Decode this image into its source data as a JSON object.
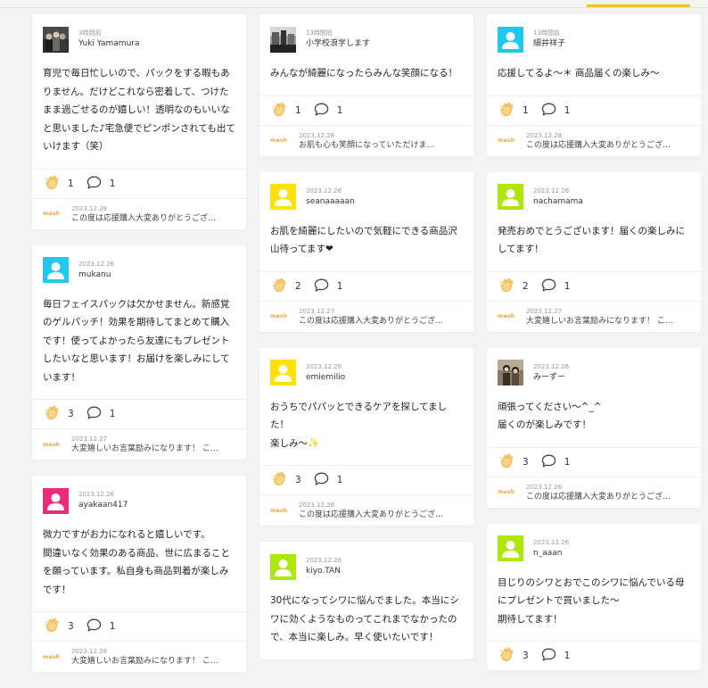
{
  "brand_label": "mash",
  "columns": [
    [
      {
        "avatar": "photo-group",
        "time": "3時間前",
        "user": "Yuki Yamamura",
        "text": "育児で毎日忙しいので、パックをする暇もありません。だけどこれなら密着して、つけたまま過ごせるのが嬉しい！透明なのもいいなと思いました♪宅急便でピンポンされても出ていけます（笑）",
        "claps": "1",
        "comments": "1",
        "reply_date": "2023.12.28",
        "reply_text": "この度は応援購入大変ありがとうござ…"
      },
      {
        "avatar": "cyan",
        "time": "2023.12.26",
        "user": "mukanu",
        "text": "毎日フェイスパックは欠かせません。新感覚のゲルパッチ！効果を期待してまとめて購入です！使ってよかったら友達にもプレゼントしたいなと思います！お届けを楽しみにしています！",
        "claps": "3",
        "comments": "1",
        "reply_date": "2023.12.27",
        "reply_text": "大変嬉しいお言葉励みになります！ こ…"
      },
      {
        "avatar": "pink",
        "time": "2023.12.26",
        "user": "ayakaan417",
        "text": "微力ですがお力になれると嬉しいです。\n間違いなく効果のある商品、世に広まることを願っています。私自身も商品到着が楽しみです！",
        "claps": "3",
        "comments": "1",
        "reply_date": "2023.12.26",
        "reply_text": "大変嬉しいお言葉励みになります！ こ…"
      }
    ],
    [
      {
        "avatar": "photo-street",
        "time": "13時間前",
        "user": "小学校浪学します",
        "text": "みんなが綺麗になったらみんな笑顔になる！",
        "claps": "1",
        "comments": "1",
        "reply_date": "2023.12.28",
        "reply_text": "お肌も心も笑顔になっていただけま…"
      },
      {
        "avatar": "yellow",
        "time": "2023.12.26",
        "user": "seanaaaaan",
        "text": "お肌を綺麗にしたいので気軽にできる商品沢山待ってます❤",
        "claps": "2",
        "comments": "1",
        "reply_date": "2023.12.27",
        "reply_text": "この度は応援購入大変ありがとうござ…"
      },
      {
        "avatar": "yellow",
        "time": "2023.12.26",
        "user": "emiemilio",
        "text": "おうちでパパッとできるケアを探してました！\n楽しみ～✨",
        "claps": "3",
        "comments": "1",
        "reply_date": "2023.12.26",
        "reply_text": "この度は応援購入大変ありがとうござ…"
      },
      {
        "avatar": "lime",
        "time": "2023.12.26",
        "user": "kiyo.TAN",
        "text": "30代になってシワに悩んでました。本当にシワに効くようなものってこれまでなかったので、本当に楽しみ。早く使いたいです！",
        "claps": "",
        "comments": "",
        "reply_date": "",
        "reply_text": ""
      }
    ],
    [
      {
        "avatar": "cyan",
        "time": "13時間前",
        "user": "細井祥子",
        "text": "応援してるよ～＊ 商品届くの楽しみ～",
        "claps": "1",
        "comments": "1",
        "reply_date": "2023.12.28",
        "reply_text": "この度は応援購入大変ありがとうござ…"
      },
      {
        "avatar": "lime",
        "time": "2023.12.26",
        "user": "nachamama",
        "text": "発売おめでとうございます！届くの楽しみにしてます！",
        "claps": "2",
        "comments": "1",
        "reply_date": "2023.12.27",
        "reply_text": "大変嬉しいお言葉励みになります！ こ…"
      },
      {
        "avatar": "photo-girl",
        "time": "2023.12.26",
        "user": "みーずー",
        "text": "頑張ってください～^_^\n届くのが楽しみです！",
        "claps": "3",
        "comments": "1",
        "reply_date": "2023.12.26",
        "reply_text": "この度は応援購入大変ありがとうござ…"
      },
      {
        "avatar": "lime",
        "time": "2023.12.26",
        "user": "n_aaan",
        "text": "目じりのシワとおでこのシワに悩んでいる母にプレゼントで買いました～\n期待してます！",
        "claps": "3",
        "comments": "1",
        "reply_date": "",
        "reply_text": ""
      }
    ]
  ],
  "colors": {
    "cyan": "#1ec8ef",
    "pink": "#ee2a7b",
    "yellow": "#ffe000",
    "lime": "#aee80a",
    "accent": "#f4c21b",
    "clap": "#f1b64a"
  }
}
